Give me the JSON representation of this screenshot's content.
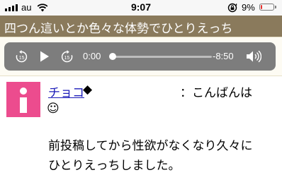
{
  "status_bar": {
    "carrier": "au",
    "time": "9:07",
    "battery_percent_label": "9%",
    "battery_level": 0.09,
    "battery_color": "#e8322f"
  },
  "page": {
    "title": "四つん這いとか色々な体勢でひとりえっち",
    "title_bar_color": "#8a7a5c"
  },
  "player": {
    "current_time": "0:00",
    "remaining_time": "-8:50",
    "progress": 0,
    "icons": [
      "skip-back-15-icon",
      "play-icon",
      "skip-forward-15-icon",
      "volume-icon"
    ]
  },
  "post": {
    "author": "チョコ",
    "author_suffix": "◆",
    "greeting": "：こんばんは",
    "emoji": "☺",
    "body_lines": [
      "前投稿してから性欲がなくなり久々に",
      "ひとりえっちしました。"
    ],
    "avatar_color": "#ec4c8e"
  }
}
